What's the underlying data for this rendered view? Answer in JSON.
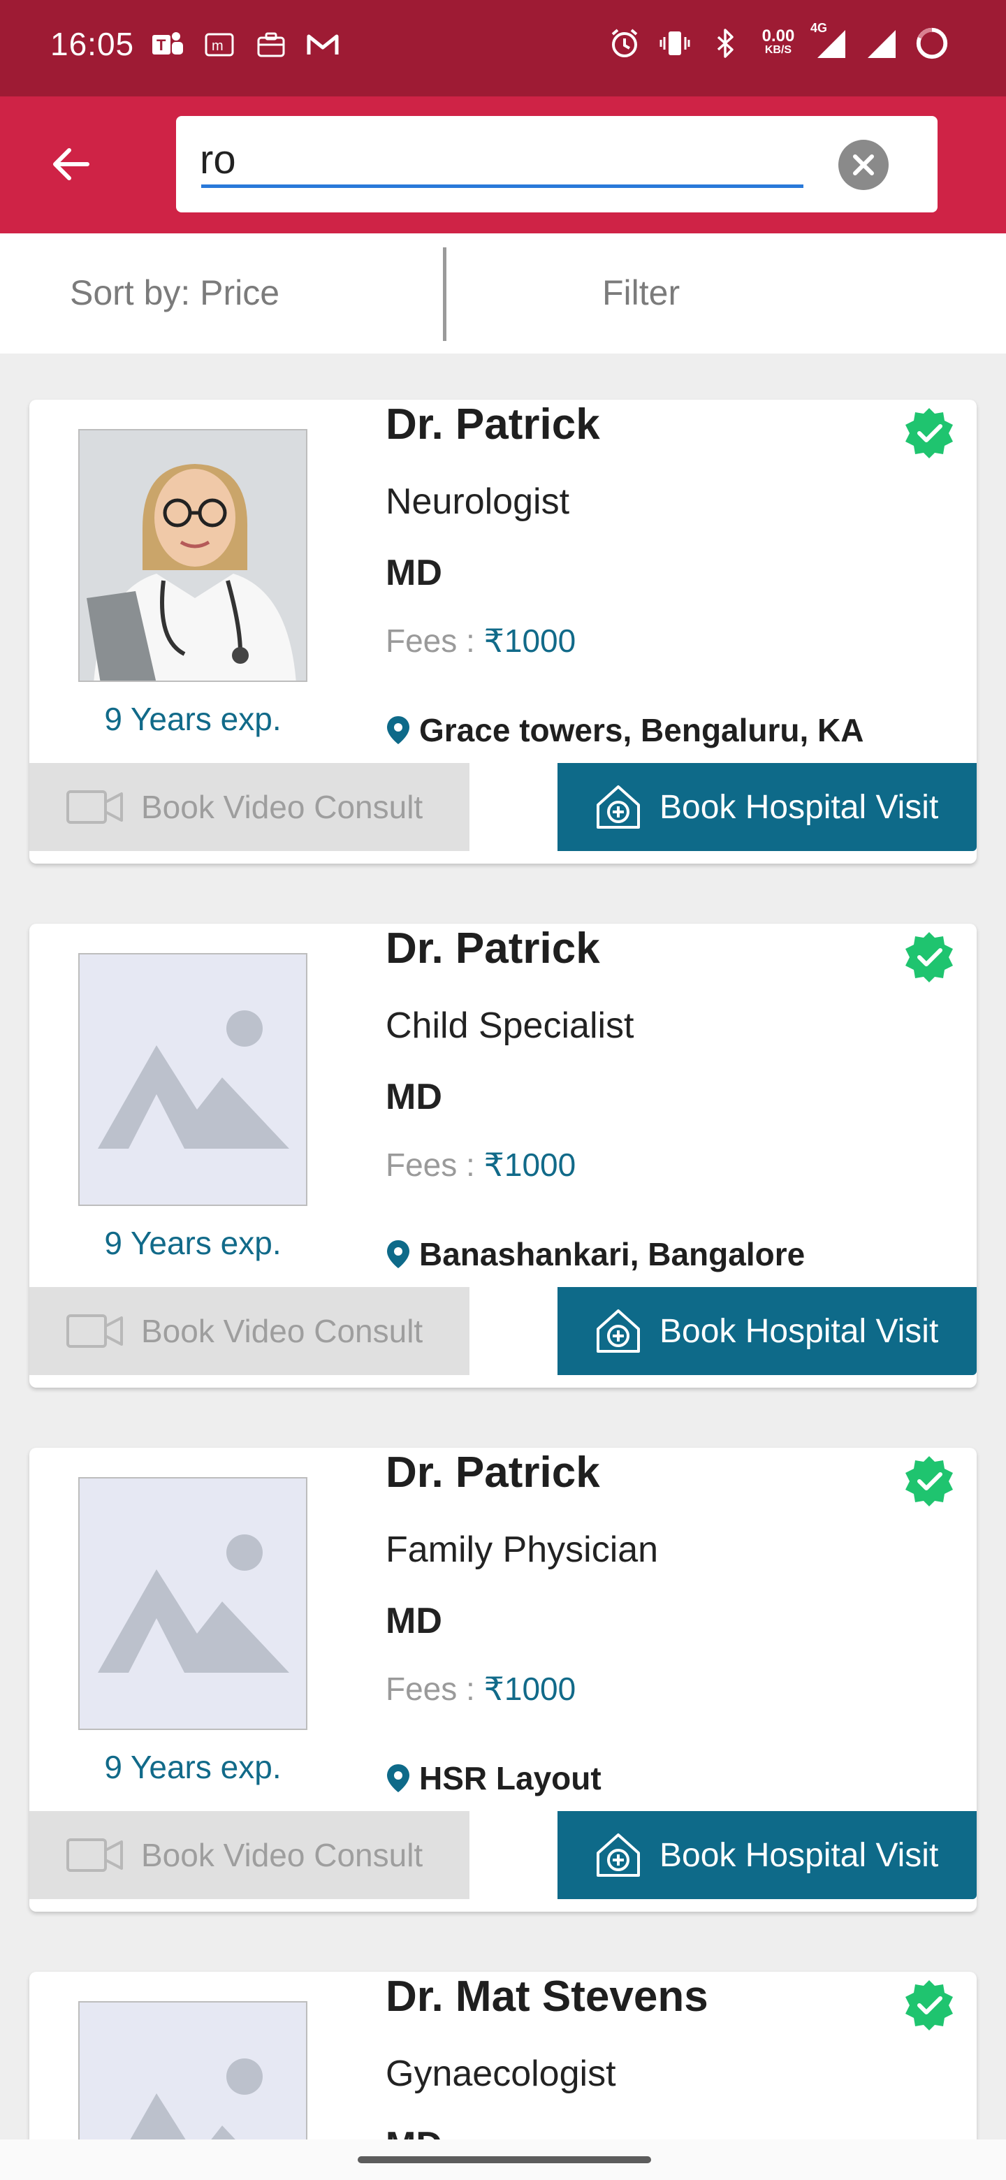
{
  "status_bar": {
    "time": "16:05",
    "net_speed_value": "0.00",
    "net_speed_unit": "KB/S",
    "network_type": "4G",
    "bg_color": "#9e1b34"
  },
  "header": {
    "bg_color": "#cf2346",
    "search_value": "ro",
    "back_icon": "arrow-left-icon",
    "clear_icon": "close-circle-icon"
  },
  "toolbar": {
    "sort_label": "Sort by: Price",
    "filter_label": "Filter"
  },
  "doctors": [
    {
      "name": "Dr. Patrick",
      "specialty": "Neurologist",
      "degree": "MD",
      "fees_label": "Fees : ",
      "fees_amount": "₹1000",
      "experience": "9 Years exp.",
      "address": "Grace towers, Bengaluru, KA",
      "photo": "doctor-photo",
      "verified": true,
      "video_btn": "Book Video Consult",
      "hospital_btn": "Book Hospital Visit"
    },
    {
      "name": "Dr. Patrick",
      "specialty": "Child Specialist",
      "degree": "MD",
      "fees_label": "Fees : ",
      "fees_amount": "₹1000",
      "experience": "9 Years exp.",
      "address": "Banashankari, Bangalore",
      "photo": "placeholder-image",
      "verified": true,
      "video_btn": "Book Video Consult",
      "hospital_btn": "Book Hospital Visit"
    },
    {
      "name": "Dr. Patrick",
      "specialty": "Family Physician",
      "degree": "MD",
      "fees_label": "Fees : ",
      "fees_amount": "₹1000",
      "experience": "9 Years exp.",
      "address": "HSR Layout",
      "photo": "placeholder-image",
      "verified": true,
      "video_btn": "Book Video Consult",
      "hospital_btn": "Book Hospital Visit"
    },
    {
      "name": "Dr. Mat Stevens",
      "specialty": "Gynaecologist",
      "degree": "MD",
      "photo": "placeholder-image",
      "verified": true
    }
  ],
  "colors": {
    "accent_teal": "#0e6a89",
    "verified_green": "#1fc46f",
    "disabled_grey": "#e0e0e0"
  }
}
